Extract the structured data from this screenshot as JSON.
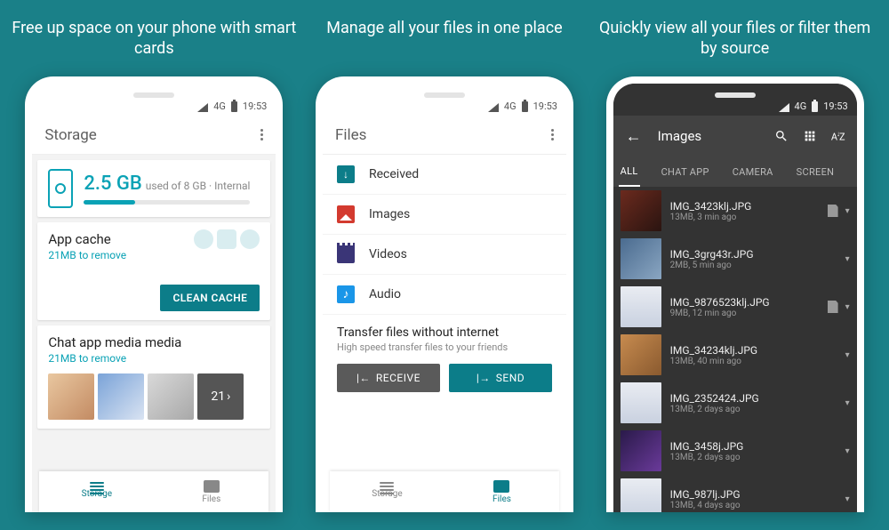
{
  "captions": {
    "c1": "Free up space on your phone with smart cards",
    "c2": "Manage all your files in one place",
    "c3": "Quickly view all your files or filter them by source"
  },
  "status": {
    "net": "4G",
    "time": "19:53"
  },
  "screen1": {
    "title": "Storage",
    "usage_value": "2.5 GB",
    "usage_label": "used of 8 GB · Internal",
    "usage_percent": 31,
    "card_cache": {
      "title": "App cache",
      "sub": "21MB to remove",
      "button": "CLEAN CACHE"
    },
    "card_media": {
      "title": "Chat app media media",
      "sub": "21MB to remove",
      "more_count": "21"
    },
    "nav": {
      "storage": "Storage",
      "files": "Files"
    }
  },
  "screen2": {
    "title": "Files",
    "categories": [
      {
        "icon": "received",
        "label": "Received"
      },
      {
        "icon": "images",
        "label": "Images"
      },
      {
        "icon": "videos",
        "label": "Videos"
      },
      {
        "icon": "audio",
        "label": "Audio"
      }
    ],
    "transfer": {
      "title": "Transfer files without internet",
      "sub": "High speed transfer files to your friends",
      "receive": "RECEIVE",
      "send": "SEND"
    },
    "nav": {
      "storage": "Storage",
      "files": "Files"
    }
  },
  "screen3": {
    "title": "Images",
    "tabs": [
      "ALL",
      "CHAT APP",
      "CAMERA",
      "SCREEN"
    ],
    "sort_label": "AZ",
    "items": [
      {
        "name": "IMG_3423klj.JPG",
        "meta": "13MB, 3 min ago",
        "sd": true
      },
      {
        "name": "IMG_3grg43r.JPG",
        "meta": "2MB, 5 min ago",
        "sd": false
      },
      {
        "name": "IMG_9876523klj.JPG",
        "meta": "9MB, 12 min ago",
        "sd": true
      },
      {
        "name": "IMG_34234klj.JPG",
        "meta": "13MB, 40 min ago",
        "sd": false
      },
      {
        "name": "IMG_2352424.JPG",
        "meta": "13MB, 2 days ago",
        "sd": false
      },
      {
        "name": "IMG_3458j.JPG",
        "meta": "13MB, 2 days ago",
        "sd": false
      },
      {
        "name": "IMG_987lj.JPG",
        "meta": "13MB, 4 days ago",
        "sd": false
      }
    ]
  }
}
